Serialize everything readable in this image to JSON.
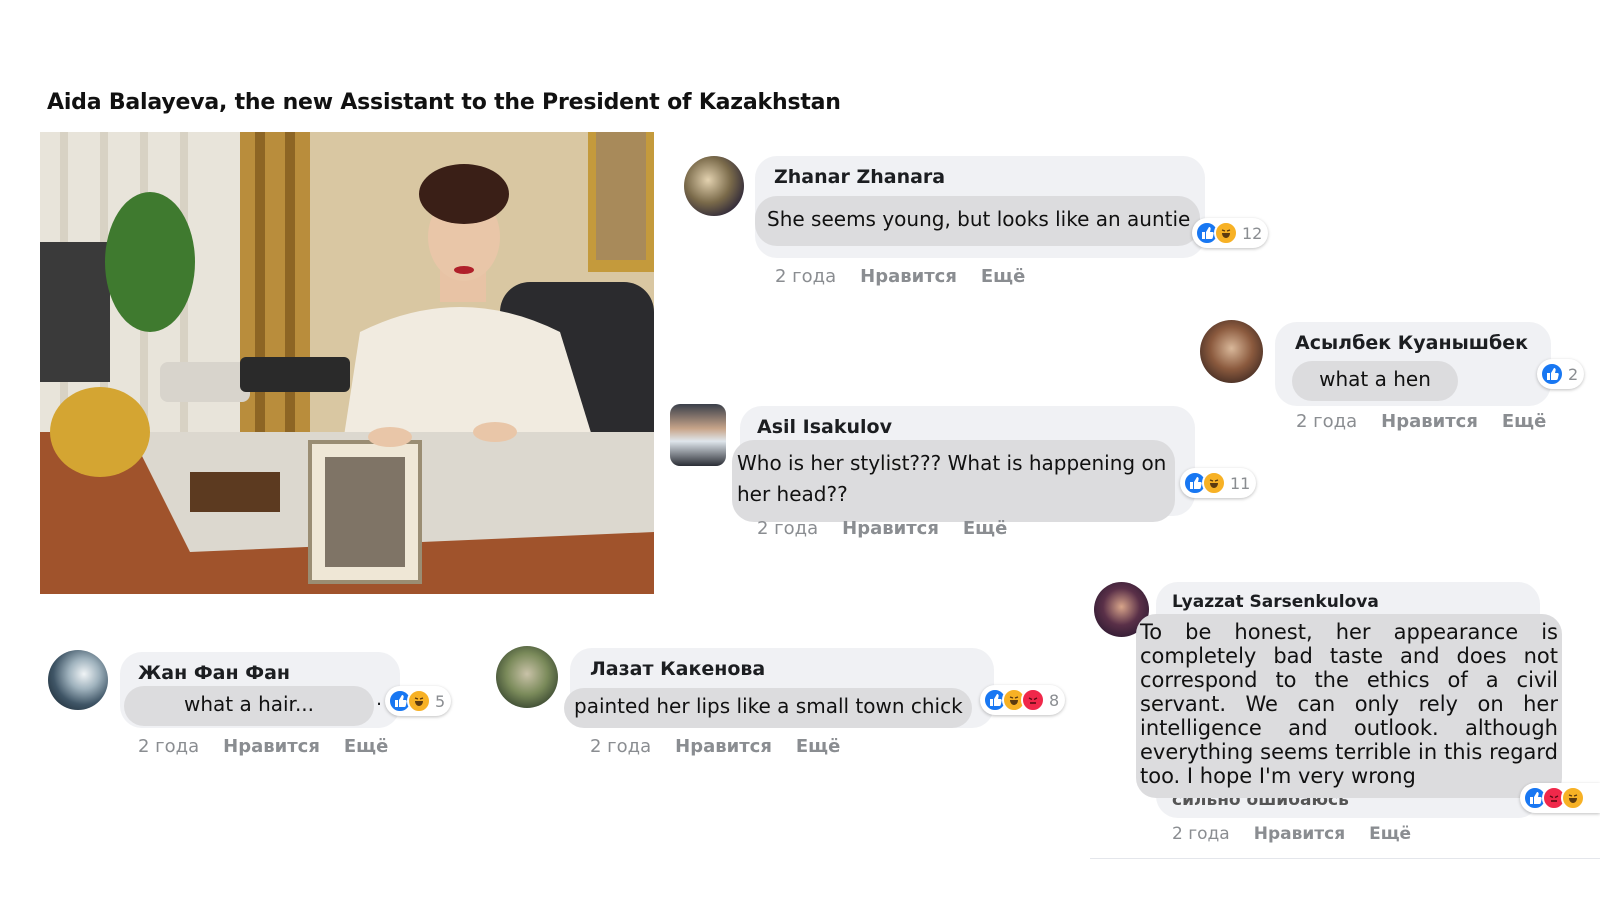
{
  "title": "Aida Balayeva, the new Assistant to the President of Kazakhstan",
  "meta_labels": {
    "time": "2 года",
    "like": "Нравится",
    "more": "Ещё"
  },
  "colors": {
    "like": "#1877f2",
    "haha": "#f7b125",
    "angry": "#f0284a",
    "bubble": "#f0f1f4",
    "pill": "#dcdcde"
  },
  "comments": [
    {
      "name": "Zhanar Zhanara",
      "text": "She seems young, but looks like an auntie",
      "reactions": [
        "like-icon",
        "haha-icon"
      ],
      "count": "12"
    },
    {
      "name": "Асылбек Куанышбек",
      "text": "what a hen",
      "reactions": [
        "like-icon"
      ],
      "count": "2"
    },
    {
      "name": "Asil Isakulov",
      "text": "Who is her stylist??? What is happening on her head??",
      "reactions": [
        "like-icon",
        "haha-icon"
      ],
      "count": "11"
    },
    {
      "name": "Lyazzat Sarsenkulova",
      "text": "To be honest, her appearance is completely bad taste and does not correspond to the ethics of a civil servant. We can only rely on her intelligence and outlook. although everything seems terrible in this regard too. I hope I'm very wrong",
      "reactions": [
        "like-icon",
        "angry-icon",
        "haha-icon"
      ],
      "count": "",
      "underlay_text": "сильно ошибаюсь"
    },
    {
      "name": "Жан Фан Фан",
      "text": "what a hair...",
      "suffix": ".",
      "reactions": [
        "like-icon",
        "haha-icon"
      ],
      "count": "5"
    },
    {
      "name": "Лазат Какенова",
      "text": "painted her lips like a small town chick",
      "reactions": [
        "like-icon",
        "haha-icon",
        "angry-icon"
      ],
      "count": "8"
    }
  ]
}
